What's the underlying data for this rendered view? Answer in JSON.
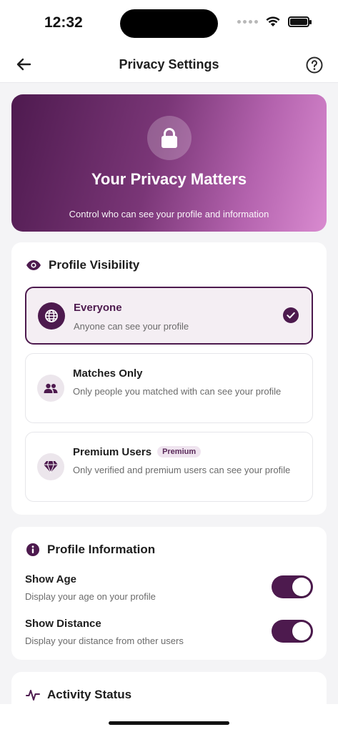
{
  "status_bar": {
    "time": "12:32"
  },
  "nav": {
    "title": "Privacy Settings"
  },
  "hero": {
    "title": "Your Privacy Matters",
    "subtitle": "Control who can see your profile and information"
  },
  "visibility": {
    "title": "Profile Visibility",
    "options": [
      {
        "title": "Everyone",
        "description": "Anyone can see your profile",
        "selected": true,
        "icon": "globe-icon"
      },
      {
        "title": "Matches Only",
        "description": "Only people you matched with can see your profile",
        "selected": false,
        "icon": "people-icon"
      },
      {
        "title": "Premium Users",
        "badge": "Premium",
        "description": "Only verified and premium users can see your profile",
        "selected": false,
        "icon": "diamond-icon"
      }
    ]
  },
  "profile_info": {
    "title": "Profile Information",
    "rows": [
      {
        "title": "Show Age",
        "description": "Display your age on your profile",
        "enabled": true
      },
      {
        "title": "Show Distance",
        "description": "Display your distance from other users",
        "enabled": true
      }
    ]
  },
  "activity": {
    "title": "Activity Status"
  },
  "colors": {
    "accent": "#4d1a4e",
    "hero_start": "#4e1a4f",
    "hero_end": "#d98bd0"
  }
}
